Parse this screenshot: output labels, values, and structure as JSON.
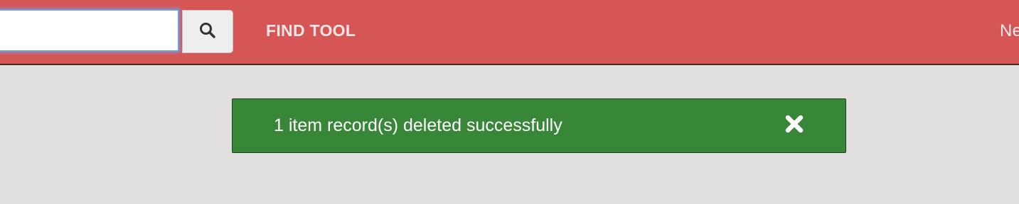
{
  "search": {
    "value": "",
    "placeholder": "",
    "button_icon": "search-icon"
  },
  "nav": {
    "find_tool_label": "FIND TOOL",
    "next_label": "Ne"
  },
  "alert": {
    "message": "1 item record(s) deleted successfully",
    "close_icon": "close-icon",
    "color": "#388638"
  },
  "colors": {
    "topbar": "#d65655",
    "background": "#e2e0de"
  }
}
